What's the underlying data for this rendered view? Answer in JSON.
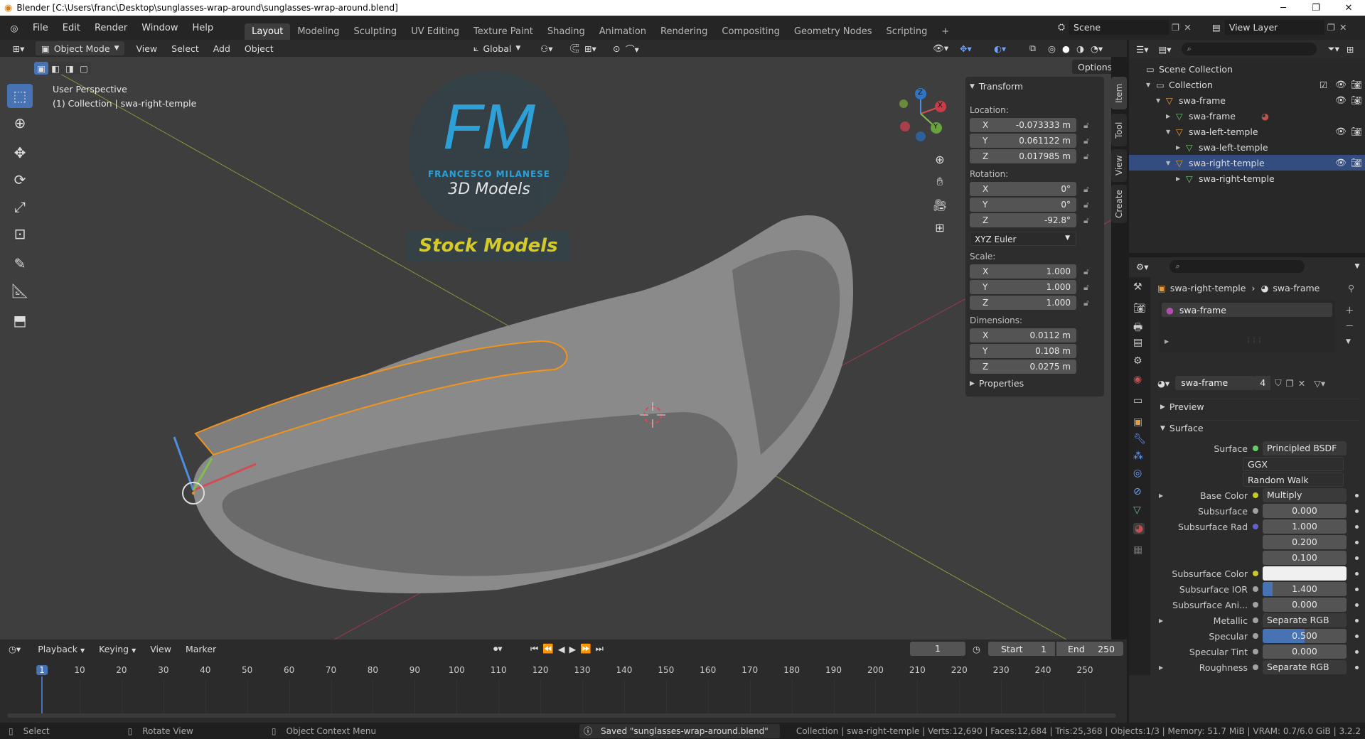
{
  "window": {
    "title": "Blender [C:\\Users\\franc\\Desktop\\sunglasses-wrap-around\\sunglasses-wrap-around.blend]"
  },
  "menu": {
    "items": [
      "File",
      "Edit",
      "Render",
      "Window",
      "Help"
    ]
  },
  "workspaces": {
    "tabs": [
      "Layout",
      "Modeling",
      "Sculpting",
      "UV Editing",
      "Texture Paint",
      "Shading",
      "Animation",
      "Rendering",
      "Compositing",
      "Geometry Nodes",
      "Scripting"
    ],
    "active": "Layout",
    "add": "+"
  },
  "scene": {
    "label": "Scene",
    "view_layer": "View Layer"
  },
  "viewport_header": {
    "mode": "Object Mode",
    "menus": [
      "View",
      "Select",
      "Add",
      "Object"
    ],
    "orientation": "Global",
    "options": "Options"
  },
  "overlay_text": {
    "perspective": "User Perspective",
    "collection": "(1) Collection | swa-right-temple"
  },
  "watermark": {
    "logo": "FM",
    "name": "FRANCESCO MILANESE",
    "sub": "3D Models",
    "banner": "Stock Models"
  },
  "gizmo": {
    "x": "X",
    "y": "Y",
    "z": "Z"
  },
  "npanel": {
    "header": "Transform",
    "location_label": "Location:",
    "location": [
      {
        "axis": "X",
        "value": "-0.073333 m"
      },
      {
        "axis": "Y",
        "value": "0.061122 m"
      },
      {
        "axis": "Z",
        "value": "0.017985 m"
      }
    ],
    "rotation_label": "Rotation:",
    "rotation": [
      {
        "axis": "X",
        "value": "0°"
      },
      {
        "axis": "Y",
        "value": "0°"
      },
      {
        "axis": "Z",
        "value": "-92.8°"
      }
    ],
    "rotation_mode": "XYZ Euler",
    "scale_label": "Scale:",
    "scale": [
      {
        "axis": "X",
        "value": "1.000"
      },
      {
        "axis": "Y",
        "value": "1.000"
      },
      {
        "axis": "Z",
        "value": "1.000"
      }
    ],
    "dimensions_label": "Dimensions:",
    "dimensions": [
      {
        "axis": "X",
        "value": "0.0112 m"
      },
      {
        "axis": "Y",
        "value": "0.108 m"
      },
      {
        "axis": "Z",
        "value": "0.0275 m"
      }
    ],
    "properties": "Properties",
    "tabs": [
      "Item",
      "Tool",
      "View",
      "Create"
    ]
  },
  "outliner": {
    "rows": [
      {
        "label": "Scene Collection"
      },
      {
        "label": "Collection"
      },
      {
        "label": "swa-frame"
      },
      {
        "label": "swa-frame"
      },
      {
        "label": "swa-left-temple"
      },
      {
        "label": "swa-left-temple"
      },
      {
        "label": "swa-right-temple"
      },
      {
        "label": "swa-right-temple"
      }
    ]
  },
  "properties": {
    "breadcrumb_object": "swa-right-temple",
    "breadcrumb_material": "swa-frame",
    "slot": "swa-frame",
    "material_name": "swa-frame",
    "users": "4",
    "preview": "Preview",
    "surface_section": "Surface",
    "rows": [
      {
        "label": "Surface",
        "value": "Principled BSDF",
        "dot": "#6c6"
      },
      {
        "label": "",
        "value": "GGX"
      },
      {
        "label": "",
        "value": "Random Walk"
      },
      {
        "label": "Base Color",
        "value": "Multiply",
        "dot": "#c7c729"
      },
      {
        "label": "Subsurface",
        "value": "0.000",
        "dot": "#a1a1a1"
      },
      {
        "label": "Subsurface Rad",
        "value": "1.000",
        "dot": "#6363c7"
      },
      {
        "label": "",
        "value": "0.200"
      },
      {
        "label": "",
        "value": "0.100"
      },
      {
        "label": "Subsurface Color",
        "value": "",
        "dot": "#c7c729"
      },
      {
        "label": "Subsurface IOR",
        "value": "1.400",
        "dot": "#a1a1a1",
        "fill": 0.12
      },
      {
        "label": "Subsurface Ani...",
        "value": "0.000",
        "dot": "#a1a1a1"
      },
      {
        "label": "Metallic",
        "value": "Separate RGB",
        "dot": "#a1a1a1"
      },
      {
        "label": "Specular",
        "value": "0.500",
        "dot": "#a1a1a1",
        "fill": 0.5
      },
      {
        "label": "Specular Tint",
        "value": "0.000",
        "dot": "#a1a1a1"
      },
      {
        "label": "Roughness",
        "value": "Separate RGB",
        "dot": "#a1a1a1"
      }
    ]
  },
  "timeline": {
    "menus": [
      "Playback",
      "Keying",
      "View",
      "Marker"
    ],
    "current_frame": "1",
    "start_label": "Start",
    "start": "1",
    "end_label": "End",
    "end": "250",
    "ticks": [
      "1",
      "10",
      "20",
      "30",
      "40",
      "50",
      "60",
      "70",
      "80",
      "90",
      "100",
      "110",
      "120",
      "130",
      "140",
      "150",
      "160",
      "170",
      "180",
      "190",
      "200",
      "210",
      "220",
      "230",
      "240",
      "250"
    ]
  },
  "status": {
    "select": "Select",
    "rotate": "Rotate View",
    "context": "Object Context Menu",
    "saved": "Saved \"sunglasses-wrap-around.blend\"",
    "stats": "Collection | swa-right-temple | Verts:12,690 | Faces:12,684 | Tris:25,368 | Objects:1/3 | Memory: 51.7 MiB | VRAM: 0.7/6.0 GiB | 3.2.2"
  }
}
